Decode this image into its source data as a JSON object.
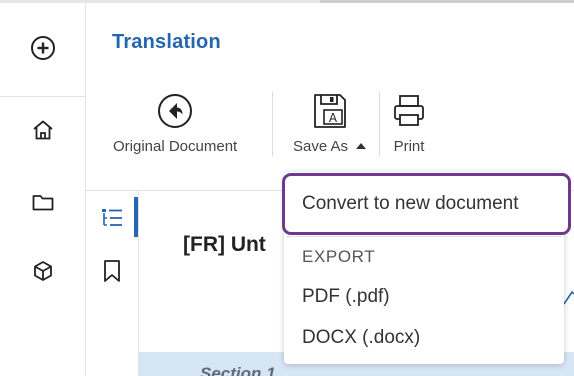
{
  "header": {
    "title": "Translation"
  },
  "rail": {
    "icons": [
      "add-circle-icon",
      "home-icon",
      "folder-icon",
      "cube-icon"
    ]
  },
  "toolbar": {
    "original_document_label": "Original Document",
    "save_as_label": "Save As",
    "print_label": "Print"
  },
  "sidepane": {
    "icons": [
      "outline-list-icon",
      "bookmark-icon"
    ],
    "active": "outline-list-icon"
  },
  "document": {
    "title_visible": "[FR] Unt",
    "section_visible": "Section 1"
  },
  "dropdown": {
    "convert_label": "Convert to new document",
    "export_heading": "EXPORT",
    "items": [
      {
        "label": "PDF (.pdf)"
      },
      {
        "label": "DOCX (.docx)"
      }
    ]
  },
  "colors": {
    "accent": "#2566b0",
    "highlight_border": "#6b3a8c",
    "section_bar": "#d7e6f4"
  }
}
